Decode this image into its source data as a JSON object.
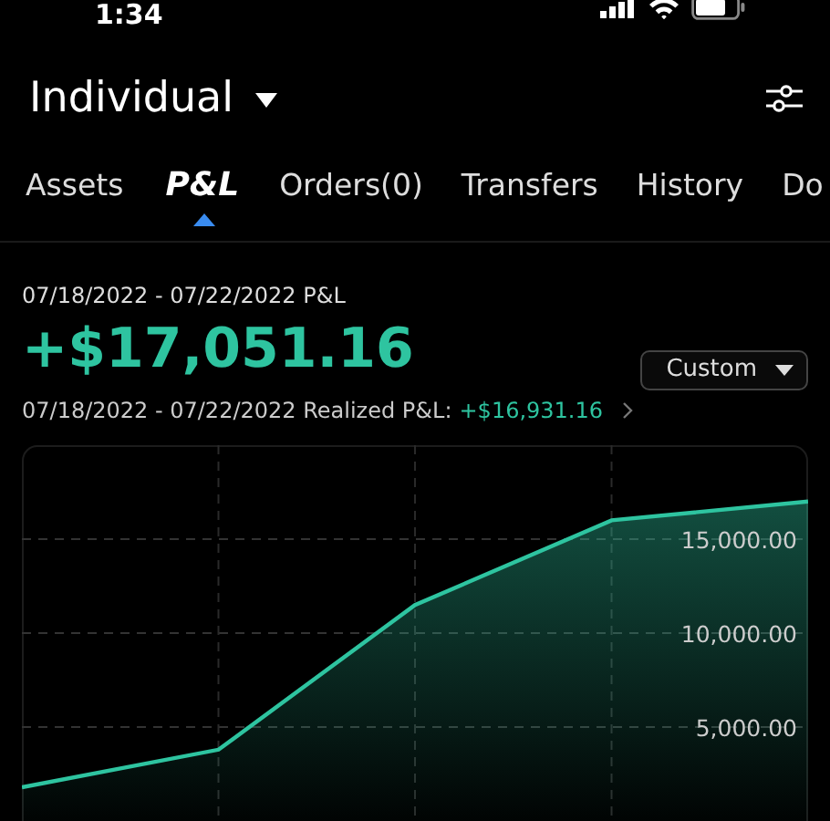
{
  "status_bar": {
    "time": "1:34"
  },
  "header": {
    "account": "Individual"
  },
  "tabs": [
    {
      "label": "Assets",
      "selected": false
    },
    {
      "label": "P&L",
      "selected": true
    },
    {
      "label": "Orders(0)",
      "selected": false
    },
    {
      "label": "Transfers",
      "selected": false
    },
    {
      "label": "History",
      "selected": false
    },
    {
      "label": "Do",
      "selected": false
    }
  ],
  "summary": {
    "period_label": "07/18/2022 - 07/22/2022 P&L",
    "total": "+$17,051.16",
    "range_selector": "Custom",
    "realized_label": "07/18/2022 - 07/22/2022 Realized P&L:",
    "realized_value": "+$16,931.16"
  },
  "chart": {
    "chart_data": {
      "type": "area",
      "grid": true,
      "series": [
        {
          "color": "#2ec4a0",
          "values": [
            1800,
            3800,
            11500,
            16000,
            17000
          ]
        }
      ],
      "ylim": [
        0,
        20000
      ],
      "yticks": [
        {
          "value": 5000,
          "label": "5,000.00"
        },
        {
          "value": 10000,
          "label": "10,000.00"
        },
        {
          "value": 15000,
          "label": "15,000.00"
        }
      ]
    }
  }
}
